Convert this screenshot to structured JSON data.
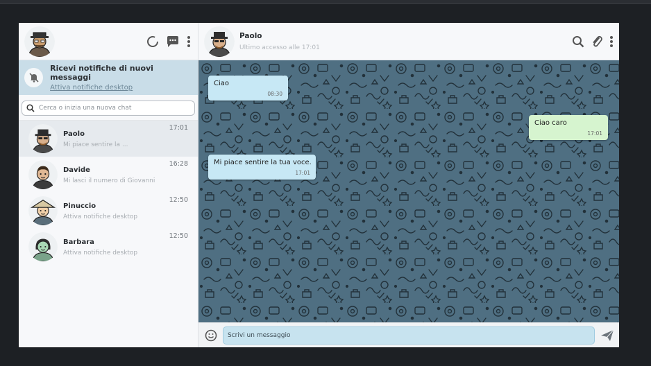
{
  "app": {
    "accent": "#c9dde8",
    "chat_bg": "#4f6f82"
  },
  "sidebar": {
    "user_avatar": "user-avatar",
    "icons": [
      "status-icon",
      "chat-icon",
      "menu-dots-icon"
    ],
    "notification": {
      "title": "Ricevi notifiche di nuovi messaggi",
      "link": "Attiva notifiche desktop",
      "icon": "bell-off-icon"
    },
    "search": {
      "placeholder": "Cerca o inizia una nuova chat",
      "icon": "search-icon"
    },
    "chats": [
      {
        "name": "Paolo",
        "preview": "Mi piace sentire la ...",
        "time": "17:01"
      },
      {
        "name": "Davide",
        "preview": "Mi lasci il numero di Giovanni",
        "time": "16:28"
      },
      {
        "name": "Pinuccio",
        "preview": "Attiva notifiche desktop",
        "time": "12:50"
      },
      {
        "name": "Barbara",
        "preview": "Attiva notifiche desktop",
        "time": "12:50"
      }
    ]
  },
  "chat": {
    "contact": {
      "name": "Paolo",
      "status": "Ultimo accesso alle 17:01"
    },
    "icons": [
      "search-icon",
      "paperclip-icon",
      "menu-dots-icon"
    ],
    "messages": [
      {
        "direction": "in",
        "text": "Ciao",
        "time": "08:30"
      },
      {
        "direction": "out",
        "text": "Ciao caro",
        "time": "17:01"
      },
      {
        "direction": "in",
        "text": "Mi piace sentire la tua voce.",
        "time": "17:01"
      }
    ],
    "composer": {
      "placeholder": "Scrivi un messaggio",
      "icons": [
        "emoji-icon",
        "send-icon"
      ]
    }
  }
}
